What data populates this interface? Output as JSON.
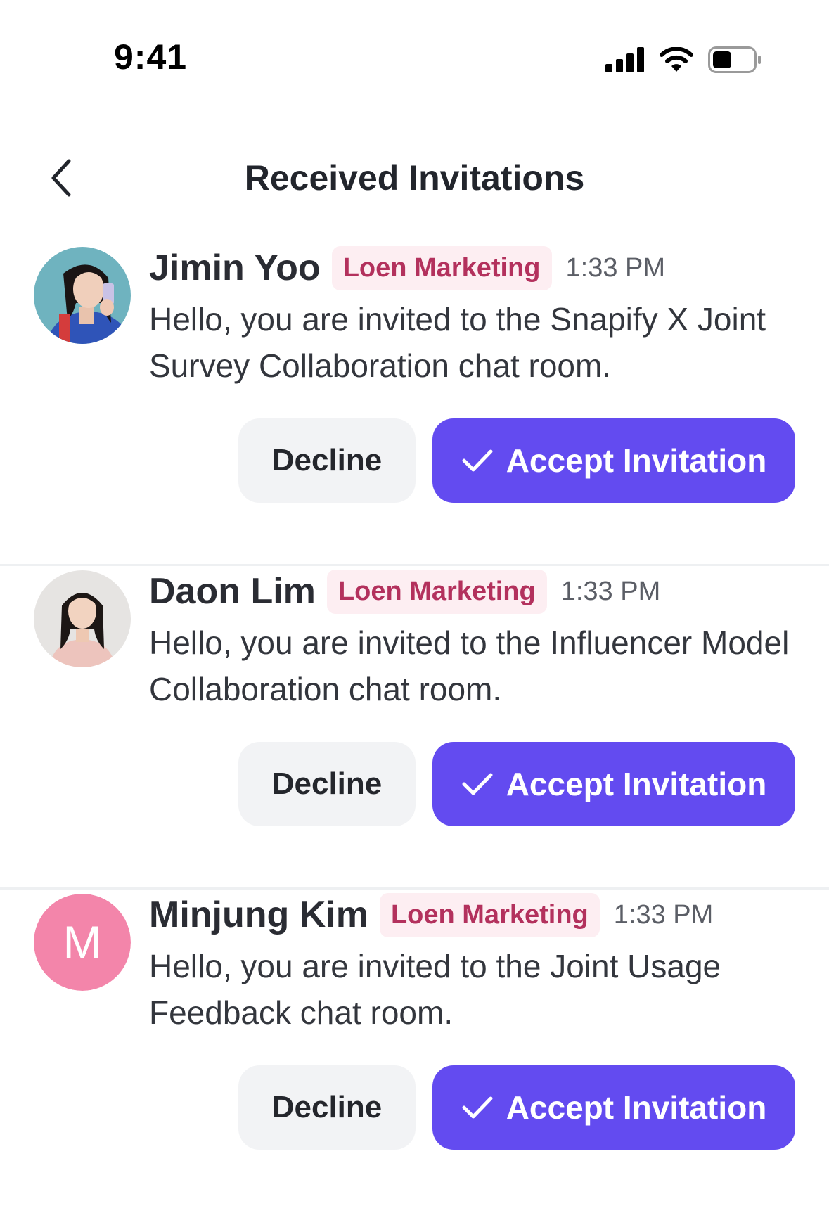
{
  "status_bar": {
    "time": "9:41",
    "icons": [
      "cellular-signal-icon",
      "wifi-icon",
      "battery-icon"
    ]
  },
  "header": {
    "back_icon": "chevron-left-icon",
    "title": "Received Invitations"
  },
  "colors": {
    "accent": "#634bf0",
    "badge_bg": "#fdeef2",
    "badge_text": "#b3315d",
    "decline_bg": "#f2f3f5",
    "avatar_letter_bg": "#f385aa"
  },
  "invitations": [
    {
      "name": "Jimin Yoo",
      "company": "Loen Marketing",
      "time": "1:33 PM",
      "message": "Hello, you are invited to the Snapify X Joint Survey Collaboration chat room.",
      "decline_label": "Decline",
      "accept_label": "Accept Invitation",
      "accept_icon": "check-icon"
    },
    {
      "name": "Daon Lim",
      "company": "Loen Marketing",
      "time": "1:33 PM",
      "message": "Hello, you are invited to the Influencer Model Collaboration chat room.",
      "decline_label": "Decline",
      "accept_label": "Accept Invitation",
      "accept_icon": "check-icon"
    },
    {
      "name": "Minjung Kim",
      "company": "Loen Marketing",
      "time": "1:33 PM",
      "message": "Hello, you are invited to the Joint Usage Feedback chat room.",
      "avatar_letter": "M",
      "decline_label": "Decline",
      "accept_label": "Accept Invitation",
      "accept_icon": "check-icon"
    }
  ]
}
